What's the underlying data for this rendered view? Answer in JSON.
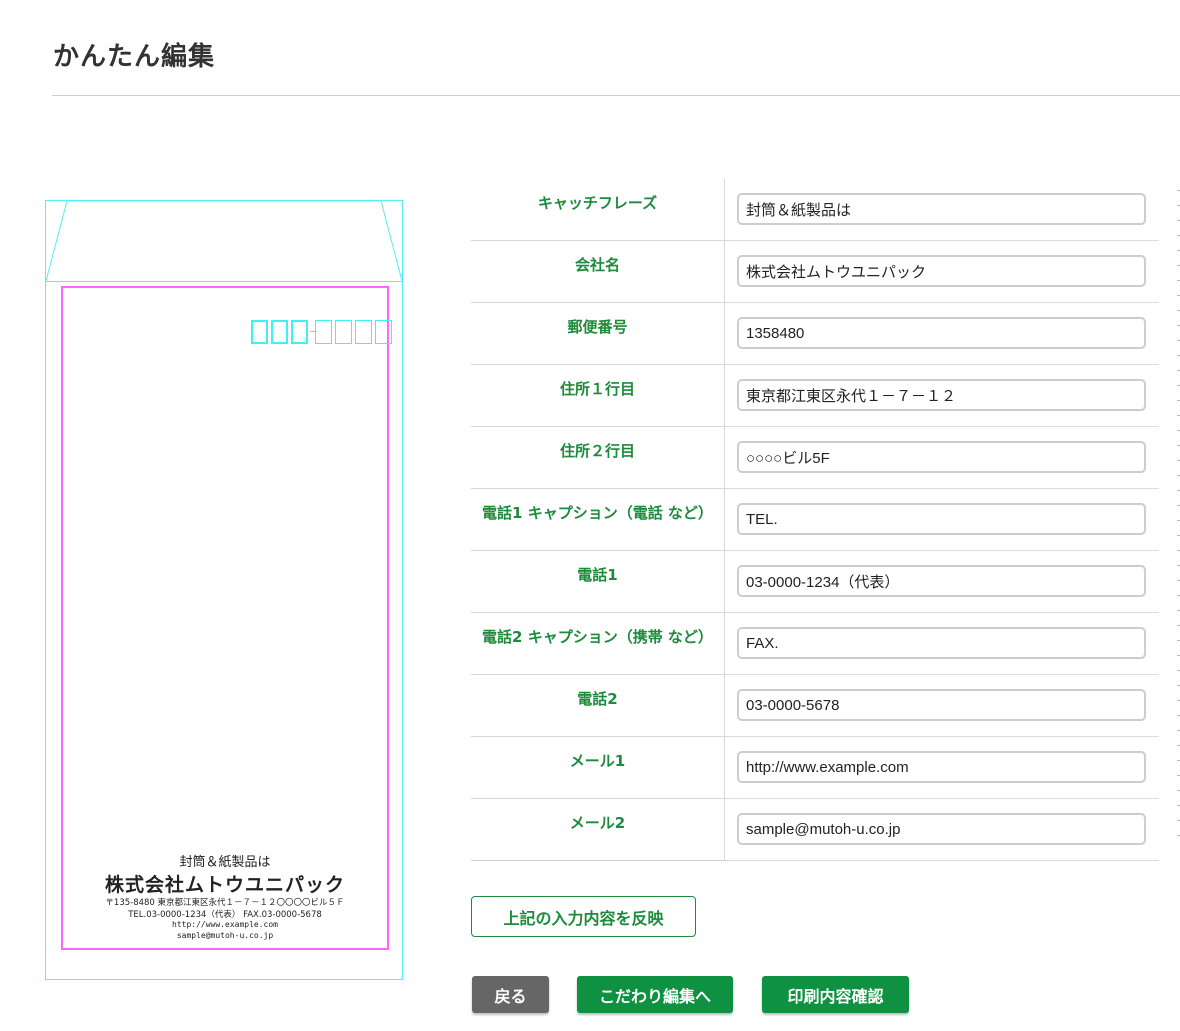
{
  "page": {
    "title": "かんたん編集"
  },
  "preview": {
    "catchphrase": "封筒＆紙製品は",
    "company": "株式会社ムトウユニパック",
    "address_line": "〒135-8480 東京都江東区永代１－７－１２〇〇〇〇ビル５Ｆ",
    "tel_line": "TEL.03-0000-1234（代表） FAX.03-0000-5678",
    "url": "http://www.example.com",
    "mail": "sample@mutoh-u.co.jp"
  },
  "form": {
    "rows": [
      {
        "label": "キャッチフレーズ",
        "value": "封筒＆紙製品は"
      },
      {
        "label": "会社名",
        "value": "株式会社ムトウユニパック"
      },
      {
        "label": "郵便番号",
        "value": "1358480"
      },
      {
        "label": "住所１行目",
        "value": "東京都江東区永代１－７－１２"
      },
      {
        "label": "住所２行目",
        "value": "○○○○ビル5F"
      },
      {
        "label": "電話1 キャプション（電話 など）",
        "value": "TEL."
      },
      {
        "label": "電話1",
        "value": "03-0000-1234（代表）"
      },
      {
        "label": "電話2 キャプション（携帯 など）",
        "value": "FAX."
      },
      {
        "label": "電話2",
        "value": "03-0000-5678"
      },
      {
        "label": "メール1",
        "value": "http://www.example.com"
      },
      {
        "label": "メール2",
        "value": "sample@mutoh-u.co.jp"
      }
    ]
  },
  "buttons": {
    "reflect": "上記の入力内容を反映",
    "back": "戻る",
    "detail_edit": "こだわり編集へ",
    "print_confirm": "印刷内容確認"
  },
  "colors": {
    "accent_green": "#0e9140",
    "label_green": "#1e8a3c",
    "back_gray": "#666666",
    "envelope_outline": "#55f0f0",
    "print_area": "#ff66ff"
  }
}
